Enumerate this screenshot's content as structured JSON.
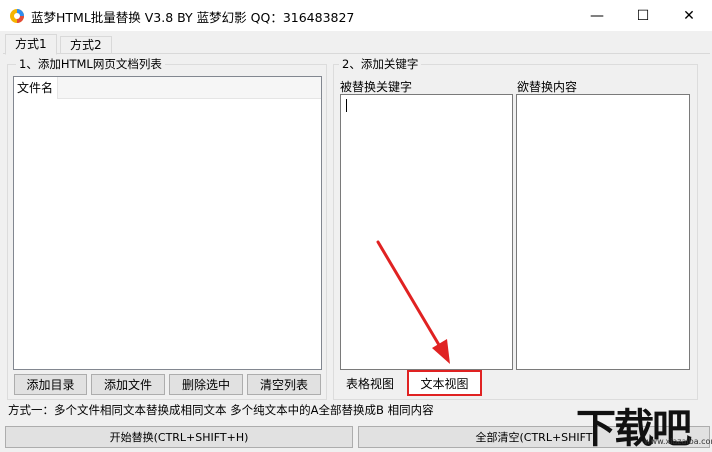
{
  "window": {
    "title": "蓝梦HTML批量替换 V3.8 BY 蓝梦幻影 QQ：316483827",
    "minimize_glyph": "—",
    "maximize_glyph": "☐",
    "close_glyph": "✕"
  },
  "tabs": [
    {
      "label": "方式1",
      "active": true
    },
    {
      "label": "方式2",
      "active": false
    }
  ],
  "left_group": {
    "title": "1、添加HTML网页文档列表",
    "columns": [
      "文件名"
    ],
    "buttons": {
      "add_dir": "添加目录",
      "add_file": "添加文件",
      "delete_selected": "删除选中",
      "clear_list": "清空列表"
    }
  },
  "right_group": {
    "title": "2、添加关键字",
    "keyword_label": "被替换关键字",
    "replace_label": "欲替换内容",
    "keyword_value": "",
    "replace_value": "",
    "view_tabs": {
      "table_view": "表格视图",
      "text_view": "文本视图"
    }
  },
  "status": "方式一：多个文件相同文本替换成相同文本   多个纯文本中的A全部替换成B 相同内容",
  "bottom_buttons": {
    "start": "开始替换(CTRL+SHIFT+H)",
    "clear_all": "全部清空(CTRL+SHIFT"
  },
  "watermark": {
    "logo_text": "下载吧",
    "url": "www.xiazaiba.com"
  },
  "colors": {
    "highlight_red": "#e02222",
    "window_bg": "#f0f0f0"
  }
}
